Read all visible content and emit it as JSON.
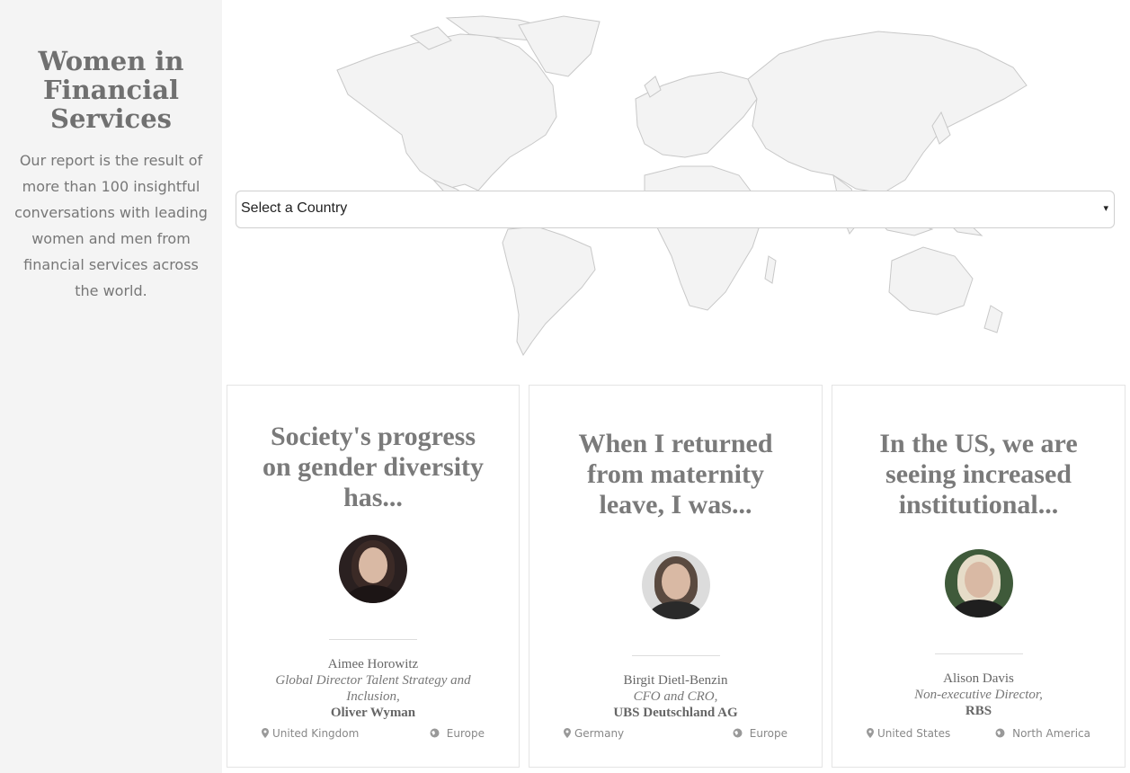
{
  "sidebar": {
    "title": "Women in Financial Services",
    "description": "Our report is the result of more than 100 insightful conversations with leading women and men from financial services across the world."
  },
  "country_select": {
    "value": "Select a Country",
    "arrow": "▾"
  },
  "cards": [
    {
      "quote": "Society's progress on gender diversity has...",
      "name": "Aimee Horowitz",
      "role": "Global Director Talent Strategy and Inclusion,",
      "organization": "Oliver Wyman",
      "country": "United Kingdom",
      "region": "Europe"
    },
    {
      "quote": "When I returned from maternity leave, I was...",
      "name": "Birgit Dietl-Benzin",
      "role": "CFO and CRO,",
      "organization": "UBS Deutschland AG",
      "country": "Germany",
      "region": "Europe"
    },
    {
      "quote": "In the US, we are seeing increased institutional...",
      "name": "Alison Davis",
      "role": "Non-executive Director,",
      "organization": "RBS",
      "country": "United States",
      "region": "North America"
    }
  ],
  "icons": {
    "location": "map-marker-icon",
    "region": "globe-icon"
  },
  "colors": {
    "sidebar_bg": "#f4f4f4",
    "map_fill": "#f3f3f3",
    "map_stroke": "#c8c8c8",
    "title_text": "#707070"
  }
}
